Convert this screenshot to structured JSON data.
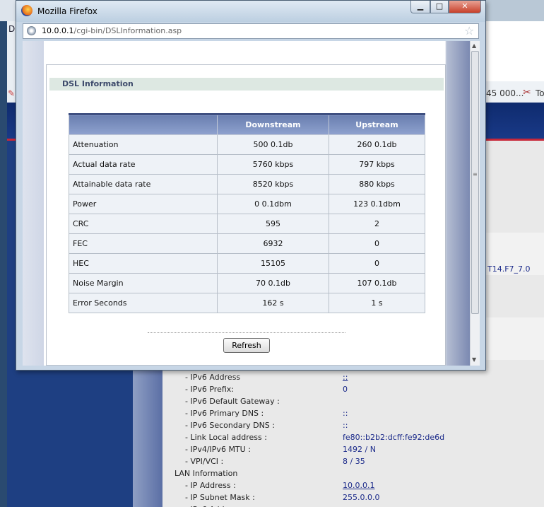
{
  "popup": {
    "title": "Mozilla Firefox",
    "url_host": "10.0.0.1",
    "url_path": "/cgi-bin/DSLInformation.asp",
    "controls": {
      "minimize": "▁",
      "maximize": "□",
      "close": "✕"
    }
  },
  "dsl": {
    "section_title": "DSL Information",
    "columns": [
      "",
      "Downstream",
      "Upstream"
    ],
    "rows": [
      {
        "label": "Attenuation",
        "down": "500 0.1db",
        "up": "260 0.1db"
      },
      {
        "label": "Actual data rate",
        "down": "5760 kbps",
        "up": "797 kbps"
      },
      {
        "label": "Attainable data rate",
        "down": "8520 kbps",
        "up": "880 kbps"
      },
      {
        "label": "Power",
        "down": "0 0.1dbm",
        "up": "123 0.1dbm"
      },
      {
        "label": "CRC",
        "down": "595",
        "up": "2"
      },
      {
        "label": "FEC",
        "down": "6932",
        "up": "0"
      },
      {
        "label": "HEC",
        "down": "15105",
        "up": "0"
      },
      {
        "label": "Noise Margin",
        "down": "70 0.1db",
        "up": "107 0.1db"
      },
      {
        "label": "Error Seconds",
        "down": "162 s",
        "up": "1 s"
      }
    ],
    "refresh_label": "Refresh"
  },
  "background": {
    "left_tab_letter": "D",
    "toolbar_number": "45 000...",
    "toolbar_text": "To",
    "version_text": "T14.F7_7.0",
    "info_rows": [
      {
        "label": "- IPv6 Address",
        "value": "::",
        "link": true
      },
      {
        "label": "- IPv6 Prefix:",
        "value": "0"
      },
      {
        "label": "- IPv6 Default Gateway :",
        "value": ""
      },
      {
        "label": "- IPv6 Primary DNS :",
        "value": "::"
      },
      {
        "label": "- IPv6 Secondary DNS :",
        "value": "::"
      },
      {
        "label": "- Link Local address :",
        "value": "fe80::b2b2:dcff:fe92:de6d"
      },
      {
        "label": "- IPv4/IPv6 MTU :",
        "value": "1492 / N"
      },
      {
        "label": "- VPI/VCI :",
        "value": "8 / 35"
      },
      {
        "label": "LAN Information",
        "value": "",
        "section": true
      },
      {
        "label": "- IP Address :",
        "value": "10.0.0.1",
        "link": true
      },
      {
        "label": "- IP Subnet Mask :",
        "value": "255.0.0.0"
      },
      {
        "label": "- IPv6 Address",
        "value": "::"
      }
    ]
  }
}
